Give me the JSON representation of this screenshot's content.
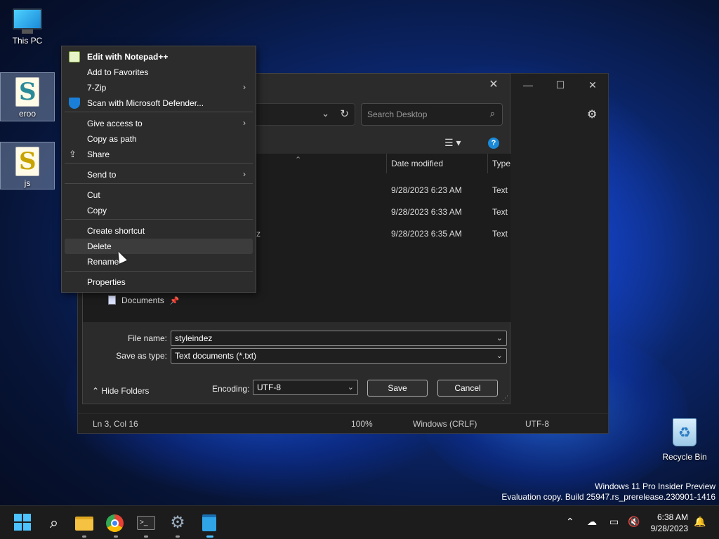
{
  "desktop": {
    "icons": [
      {
        "label": "This PC"
      },
      {
        "label": "eroo"
      },
      {
        "label": "js"
      }
    ],
    "recycle_bin_label": "Recycle Bin",
    "watermark_line1": "Windows 11 Pro Insider Preview",
    "watermark_line2": "Evaluation copy. Build 25947.rs_prerelease.230901-1416"
  },
  "notepad": {
    "status": {
      "position": "Ln 3, Col 16",
      "zoom": "100%",
      "line_endings": "Windows (CRLF)",
      "encoding": "UTF-8"
    },
    "window_buttons": {
      "minimize": "—",
      "maximize": "☐",
      "close": "✕"
    }
  },
  "save_dialog": {
    "close_glyph": "✕",
    "search_placeholder": "Search Desktop",
    "columns": {
      "date_modified": "Date modified",
      "type": "Type"
    },
    "files": [
      {
        "name": "",
        "date": "9/28/2023 6:23 AM",
        "type": "Text D"
      },
      {
        "name": "",
        "date": "9/28/2023 6:33 AM",
        "type": "Text D"
      },
      {
        "name": "z",
        "date": "9/28/2023 6:35 AM",
        "type": "Text D"
      }
    ],
    "nav_documents": "Documents",
    "file_name_label": "File name:",
    "file_name_value": "styleindez",
    "save_as_type_label": "Save as type:",
    "save_as_type_value": "Text documents (*.txt)",
    "hide_folders": "Hide Folders",
    "encoding_label": "Encoding:",
    "encoding_value": "UTF-8",
    "save_button": "Save",
    "cancel_button": "Cancel"
  },
  "context_menu": {
    "items": [
      {
        "label": "Edit with Notepad++",
        "icon": "notepadpp-icon",
        "bold": true
      },
      {
        "label": "Add to Favorites"
      },
      {
        "label": "7-Zip",
        "submenu": true
      },
      {
        "label": "Scan with Microsoft Defender...",
        "icon": "defender-shield-icon"
      },
      {
        "label": "Give access to",
        "submenu": true
      },
      {
        "label": "Copy as path"
      },
      {
        "label": "Share",
        "icon": "share-icon"
      },
      {
        "label": "Send to",
        "submenu": true
      },
      {
        "label": "Cut"
      },
      {
        "label": "Copy"
      },
      {
        "label": "Create shortcut"
      },
      {
        "label": "Delete",
        "hover": true
      },
      {
        "label": "Rename"
      },
      {
        "label": "Properties"
      }
    ]
  },
  "taskbar": {
    "apps": [
      "start-icon",
      "search-icon",
      "file-explorer-icon",
      "chrome-icon",
      "terminal-icon",
      "settings-icon",
      "notepad-icon"
    ],
    "clock_time": "6:38 AM",
    "clock_date": "9/28/2023"
  },
  "colors": {
    "accent": "#4cc2ff",
    "dark_bg": "#202020",
    "menu_bg": "#2c2c2c"
  }
}
